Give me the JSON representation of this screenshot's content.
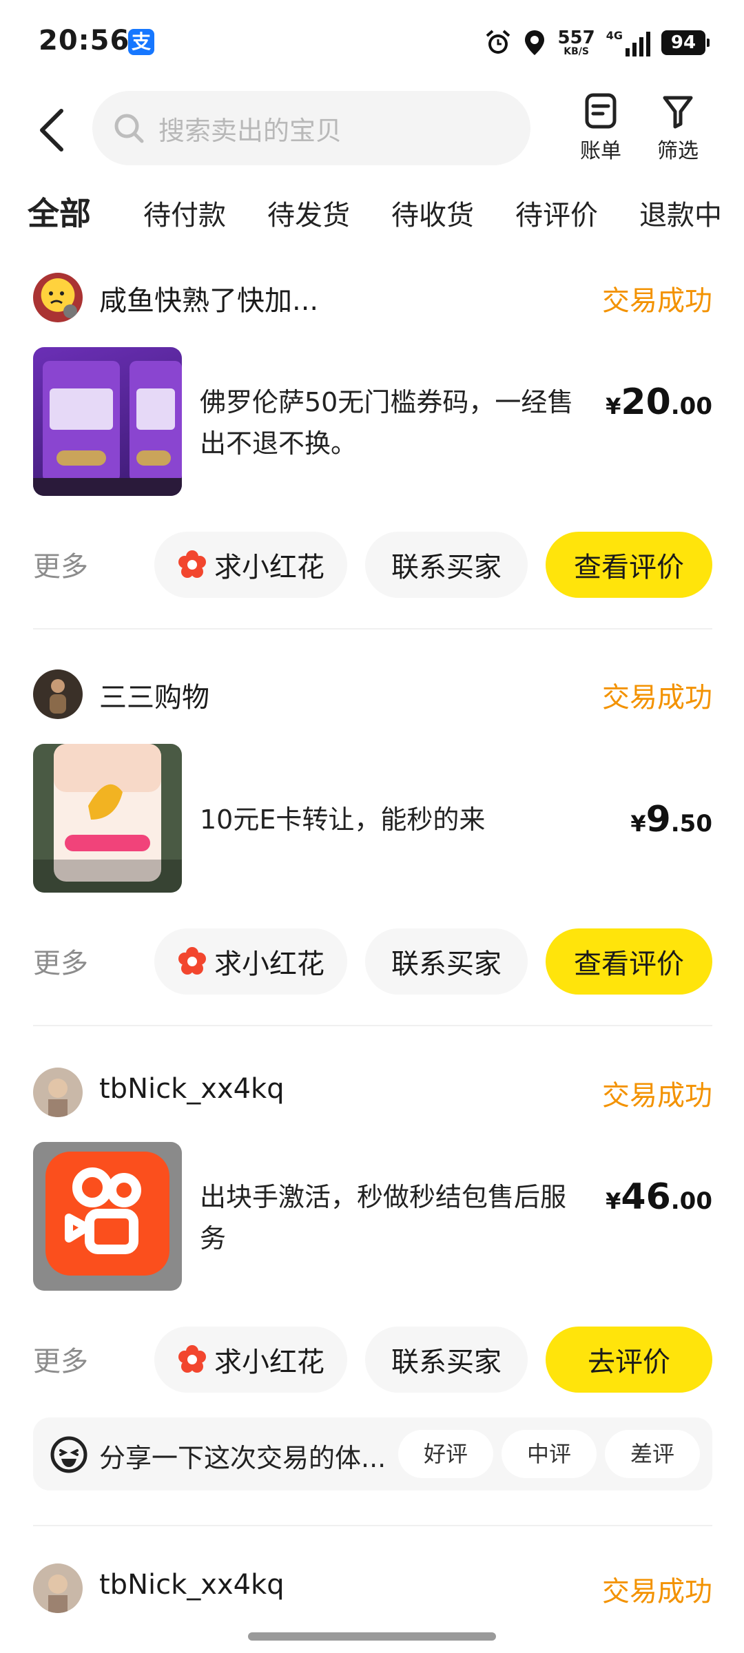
{
  "status_bar": {
    "time": "20:56",
    "alipay_icon": "支",
    "net_speed": "557",
    "net_unit": "KB/S",
    "network": "4G",
    "battery": "94"
  },
  "header": {
    "search_placeholder": "搜索卖出的宝贝",
    "bill_label": "账单",
    "filter_label": "筛选"
  },
  "tabs": [
    "全部",
    "待付款",
    "待发货",
    "待收货",
    "待评价",
    "退款中"
  ],
  "orders": [
    {
      "buyer": "咸鱼快熟了快加...",
      "status": "交易成功",
      "title": "佛罗伦萨50无门槛券码，一经售出不退不换。",
      "price_currency": "¥",
      "price_int": "20",
      "price_dec": ".00",
      "more": "更多",
      "btn_flower": "求小红花",
      "btn_contact": "联系买家",
      "btn_primary": "查看评价"
    },
    {
      "buyer": "三三购物",
      "status": "交易成功",
      "title": "10元E卡转让，能秒的来",
      "price_currency": "¥",
      "price_int": "9",
      "price_dec": ".50",
      "more": "更多",
      "btn_flower": "求小红花",
      "btn_contact": "联系买家",
      "btn_primary": "查看评价"
    },
    {
      "buyer": "tbNick_xx4kq",
      "status": "交易成功",
      "title": "出块手激活，秒做秒结包售后服务",
      "price_currency": "¥",
      "price_int": "46",
      "price_dec": ".00",
      "more": "更多",
      "btn_flower": "求小红花",
      "btn_contact": "联系买家",
      "btn_primary": "去评价",
      "share_text": "分享一下这次交易的体...",
      "ratings": [
        "好评",
        "中评",
        "差评"
      ]
    },
    {
      "buyer": "tbNick_xx4kq",
      "status": "交易成功"
    }
  ],
  "colors": {
    "accent_yellow": "#ffe40b",
    "status_orange": "#f39200"
  }
}
